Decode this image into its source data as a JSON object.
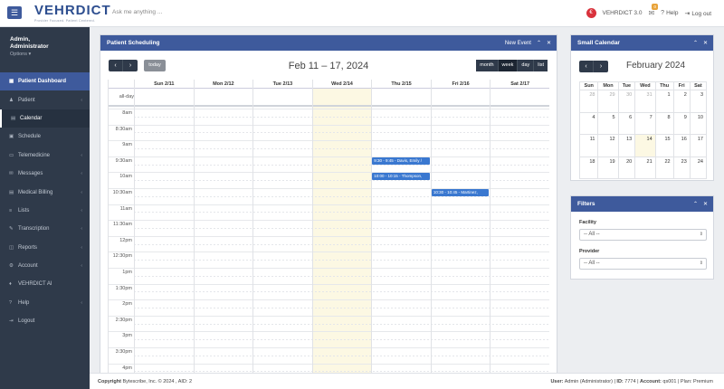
{
  "header": {
    "menu_icon": "☰",
    "logo": "VEHRDICT",
    "logo_tagline": "Provider Focused. Patient Centered.",
    "ask_placeholder": "Ask me anything ...",
    "version_icon": "€",
    "version": "VEHRDICT 3.0",
    "notifications_icon": "✉",
    "notifications_count": "0",
    "help_icon": "?",
    "help": "Help",
    "logout_icon": "⇥",
    "logout": "Log out"
  },
  "user": {
    "name": "Admin,",
    "role": "Administrator",
    "options": "Options ▾"
  },
  "sidebar": {
    "items": [
      {
        "icon": "▦",
        "label": "Patient Dashboard",
        "chevron": ""
      },
      {
        "icon": "♟",
        "label": "Patient",
        "chevron": "‹"
      },
      {
        "icon": "▤",
        "label": "Calendar",
        "chevron": ""
      },
      {
        "icon": "▣",
        "label": "Schedule",
        "chevron": ""
      },
      {
        "icon": "▭",
        "label": "Telemedicine",
        "chevron": "‹"
      },
      {
        "icon": "✉",
        "label": "Messages",
        "chevron": "‹"
      },
      {
        "icon": "▤",
        "label": "Medical Billing",
        "chevron": "‹"
      },
      {
        "icon": "≡",
        "label": "Lists",
        "chevron": "‹"
      },
      {
        "icon": "✎",
        "label": "Transcription",
        "chevron": "‹"
      },
      {
        "icon": "◫",
        "label": "Reports",
        "chevron": "‹"
      },
      {
        "icon": "⚙",
        "label": "Account",
        "chevron": "‹"
      },
      {
        "icon": "♦",
        "label": "VEHRDICT AI",
        "chevron": ""
      },
      {
        "icon": "?",
        "label": "Help",
        "chevron": "‹"
      },
      {
        "icon": "⇥",
        "label": "Logout",
        "chevron": ""
      }
    ]
  },
  "scheduling": {
    "title": "Patient Scheduling",
    "new_event": "New Event",
    "collapse_icon": "⌃",
    "close_icon": "✕",
    "prev": "‹",
    "next": "›",
    "today": "today",
    "range_title": "Feb 11 – 17, 2024",
    "views": [
      "month",
      "week",
      "day",
      "list"
    ],
    "active_view": "week",
    "days": [
      "Sun 2/11",
      "Mon 2/12",
      "Tue 2/13",
      "Wed 2/14",
      "Thu 2/15",
      "Fri 2/16",
      "Sat 2/17"
    ],
    "today_index": 3,
    "allday_label": "all-day",
    "times": [
      "8am",
      "8:30am",
      "9am",
      "9:30am",
      "10am",
      "10:30am",
      "11am",
      "11:30am",
      "12pm",
      "12:30pm",
      "1pm",
      "1:30pm",
      "2pm",
      "2:30pm",
      "3pm",
      "3:30pm",
      "4pm"
    ],
    "events": [
      {
        "text": "9:30 - 9:45 - Davis, Emily /",
        "day_index": 4,
        "start": "9:30am"
      },
      {
        "text": "10:00 - 10:15 - Thompson,",
        "day_index": 4,
        "start": "10am"
      },
      {
        "text": "10:30 - 10:45 - Martinez,",
        "day_index": 5,
        "start": "10:30am"
      }
    ]
  },
  "small_calendar": {
    "title": "Small Calendar",
    "prev": "‹",
    "next": "›",
    "month_title": "February 2024",
    "weekdays": [
      "Sun",
      "Mon",
      "Tue",
      "Wed",
      "Thu",
      "Fri",
      "Sat"
    ],
    "weeks": [
      [
        {
          "d": "28",
          "o": true
        },
        {
          "d": "29",
          "o": true
        },
        {
          "d": "30",
          "o": true
        },
        {
          "d": "31",
          "o": true
        },
        {
          "d": "1"
        },
        {
          "d": "2"
        },
        {
          "d": "3"
        }
      ],
      [
        {
          "d": "4"
        },
        {
          "d": "5"
        },
        {
          "d": "6"
        },
        {
          "d": "7"
        },
        {
          "d": "8"
        },
        {
          "d": "9"
        },
        {
          "d": "10"
        }
      ],
      [
        {
          "d": "11"
        },
        {
          "d": "12"
        },
        {
          "d": "13"
        },
        {
          "d": "14",
          "t": true
        },
        {
          "d": "15"
        },
        {
          "d": "16"
        },
        {
          "d": "17"
        }
      ],
      [
        {
          "d": "18"
        },
        {
          "d": "19"
        },
        {
          "d": "20"
        },
        {
          "d": "21"
        },
        {
          "d": "22"
        },
        {
          "d": "23"
        },
        {
          "d": "24"
        }
      ]
    ]
  },
  "filters": {
    "title": "Filters",
    "facility_label": "Facility",
    "facility_value": "-- All --",
    "provider_label": "Provider",
    "provider_value": "-- All --",
    "select_arrow": "⇕"
  },
  "footer": {
    "copyright_label": "Copyright",
    "copyright_text": "Bytescribe, Inc. © 2024 , AID: 2",
    "user_label": "User:",
    "user_value": "Admin (Administrator)",
    "id_label": "ID:",
    "id_value": "7774",
    "account_label": "Account:",
    "account_value": "qs001",
    "plan_text": "Plan: Premium"
  },
  "colors": {
    "primary": "#3e5a9c",
    "sidebar": "#2f3a4a",
    "today_highlight": "#fcf8e3",
    "event": "#3a78d0"
  }
}
